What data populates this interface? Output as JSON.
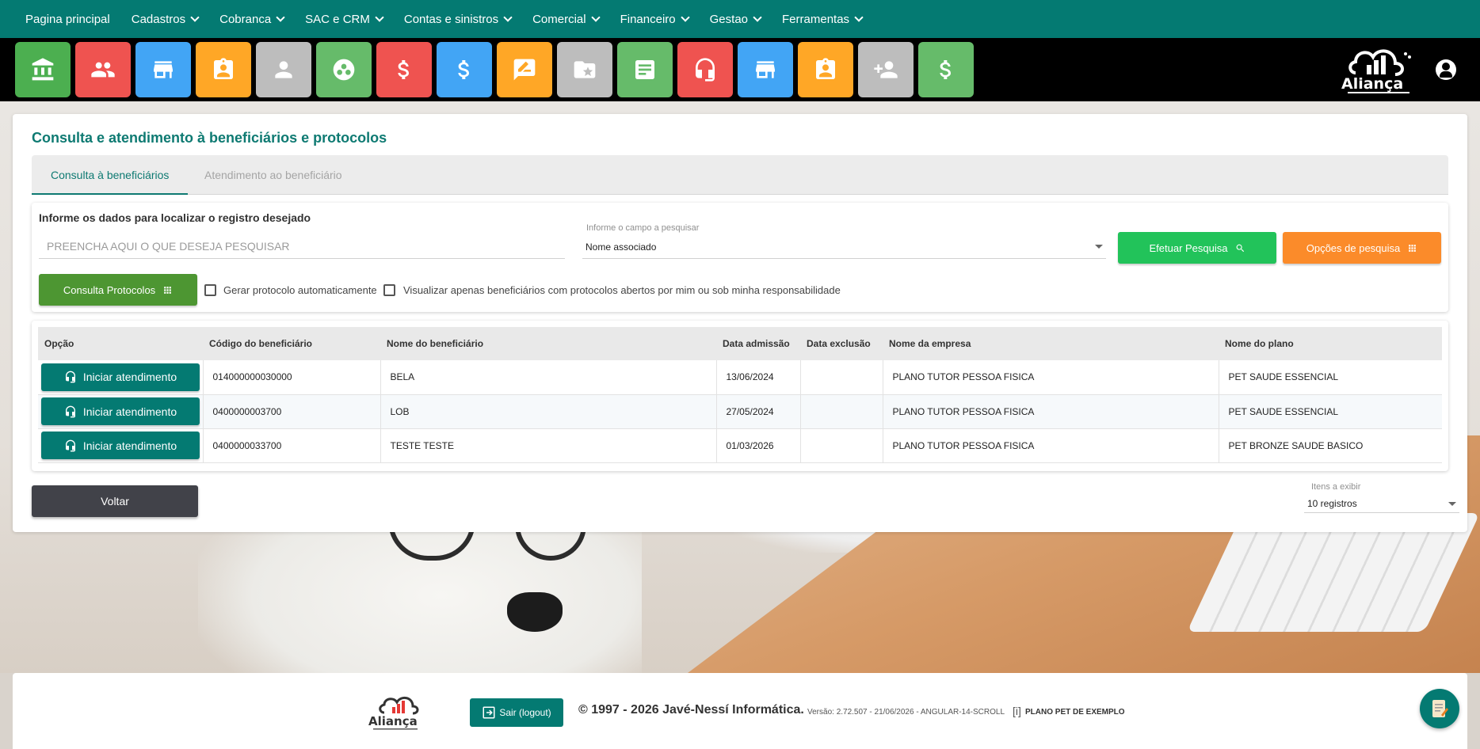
{
  "menu": {
    "items": [
      {
        "label": "Pagina principal",
        "dropdown": false
      },
      {
        "label": "Cadastros",
        "dropdown": true
      },
      {
        "label": "Cobranca",
        "dropdown": true
      },
      {
        "label": "SAC e CRM",
        "dropdown": true
      },
      {
        "label": "Contas e sinistros",
        "dropdown": true
      },
      {
        "label": "Comercial",
        "dropdown": true
      },
      {
        "label": "Financeiro",
        "dropdown": true
      },
      {
        "label": "Gestao",
        "dropdown": true
      },
      {
        "label": "Ferramentas",
        "dropdown": true
      }
    ]
  },
  "quick_tiles": [
    {
      "icon": "bank-icon",
      "color": "#4caf50"
    },
    {
      "icon": "people-icon",
      "color": "#ef5350"
    },
    {
      "icon": "store-icon",
      "color": "#42a5f5"
    },
    {
      "icon": "badge-icon",
      "color": "#ffa726"
    },
    {
      "icon": "person-icon",
      "color": "#bdbdbd"
    },
    {
      "icon": "workspaces-icon",
      "color": "#66bb6a"
    },
    {
      "icon": "dollar-icon",
      "color": "#ef5350"
    },
    {
      "icon": "dollar-icon",
      "color": "#42a5f5"
    },
    {
      "icon": "rate-review-icon",
      "color": "#ffa726"
    },
    {
      "icon": "folder-star-icon",
      "color": "#bdbdbd"
    },
    {
      "icon": "newspaper-icon",
      "color": "#66bb6a"
    },
    {
      "icon": "headset-icon",
      "color": "#ef5350"
    },
    {
      "icon": "store-icon",
      "color": "#42a5f5"
    },
    {
      "icon": "badge-icon",
      "color": "#ffa726"
    },
    {
      "icon": "person-add-icon",
      "color": "#bdbdbd"
    },
    {
      "icon": "dollar-icon",
      "color": "#66bb6a"
    }
  ],
  "brand": {
    "logo_text": "Aliança"
  },
  "page": {
    "title": "Consulta e atendimento à beneficiários e protocolos",
    "tabs": {
      "active": "Consulta à beneficiários",
      "inactive": "Atendimento ao beneficiário"
    }
  },
  "search": {
    "caption": "Informe os dados para localizar o registro desejado",
    "input_placeholder": "PREENCHA AQUI O QUE DESEJA PESQUISAR",
    "input_value": "",
    "field_label": "Informe o campo a pesquisar",
    "field_value": "Nome associado",
    "search_button": "Efetuar Pesquisa",
    "options_button": "Opções de pesquisa",
    "protocols_button": "Consulta Protocolos",
    "checkbox_auto_protocol": "Gerar protocolo automaticamente",
    "checkbox_open_only": "Visualizar apenas beneficiários com protocolos abertos por mim ou sob minha responsabilidade"
  },
  "table": {
    "headers": [
      "Opção",
      "Código do beneficiário",
      "Nome do beneficiário",
      "Data admissão",
      "Data exclusão",
      "Nome da empresa",
      "Nome do plano"
    ],
    "action_label": "Iniciar atendimento",
    "rows": [
      {
        "code": "014000000030000",
        "name": "BELA",
        "admission": "13/06/2024",
        "exclusion": "",
        "company": "PLANO TUTOR PESSOA FISICA",
        "plan": "PET SAUDE ESSENCIAL"
      },
      {
        "code": "0400000003700",
        "name": "LOB",
        "admission": "27/05/2024",
        "exclusion": "",
        "company": "PLANO TUTOR PESSOA FISICA",
        "plan": "PET SAUDE ESSENCIAL"
      },
      {
        "code": "0400000033700",
        "name": "TESTE TESTE",
        "admission": "01/03/2026",
        "exclusion": "",
        "company": "PLANO TUTOR PESSOA FISICA",
        "plan": "PET BRONZE SAUDE BASICO"
      }
    ]
  },
  "footer_controls": {
    "back_button": "Voltar",
    "items_label": "Itens a exibir",
    "items_value": "10 registros"
  },
  "footer": {
    "logout": "Sair (logout)",
    "copyright": "© 1997 - 2026 Javé-Nessí Informática.",
    "version": "Versão: 2.72.507 - 21/06/2026 - ANGULAR-14-SCROLL",
    "info_marker": "[i]",
    "plan_name": "PLANO PET DE EXEMPLO"
  }
}
